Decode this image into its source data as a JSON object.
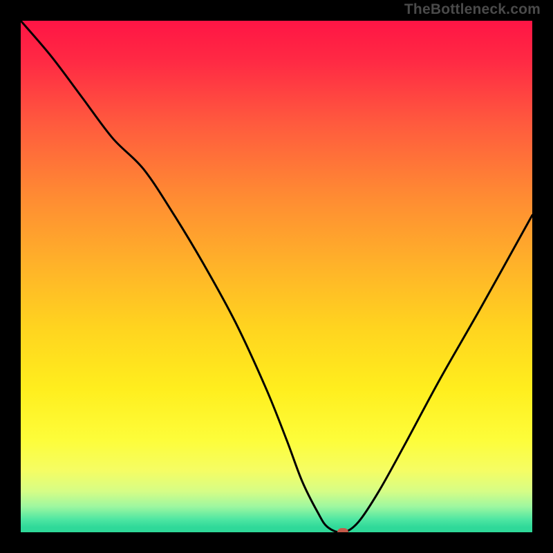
{
  "watermark": "TheBottleneck.com",
  "chart_data": {
    "type": "line",
    "title": "",
    "xlabel": "",
    "ylabel": "",
    "xlim": [
      0,
      100
    ],
    "ylim": [
      0,
      100
    ],
    "grid": false,
    "background_gradient": {
      "orientation": "vertical",
      "stops": [
        {
          "pos": 0,
          "color": "#ff1545"
        },
        {
          "pos": 20,
          "color": "#ff5a3e"
        },
        {
          "pos": 48,
          "color": "#ffb329"
        },
        {
          "pos": 72,
          "color": "#ffee1e"
        },
        {
          "pos": 92,
          "color": "#d6fd86"
        },
        {
          "pos": 100,
          "color": "#2fd999"
        }
      ]
    },
    "series": [
      {
        "name": "bottleneck-curve",
        "color": "#000000",
        "x": [
          0,
          6,
          12,
          18,
          24,
          30,
          36,
          42,
          48,
          52,
          55,
          58,
          60,
          63,
          66,
          70,
          75,
          82,
          90,
          100
        ],
        "y": [
          100,
          93,
          85,
          77,
          71,
          62,
          52,
          41,
          28,
          18,
          10,
          4,
          1,
          0,
          2,
          8,
          17,
          30,
          44,
          62
        ]
      }
    ],
    "marker": {
      "name": "optimal-point",
      "x": 63,
      "y": 0,
      "color": "#c55a4a",
      "shape": "rounded-rect"
    }
  }
}
